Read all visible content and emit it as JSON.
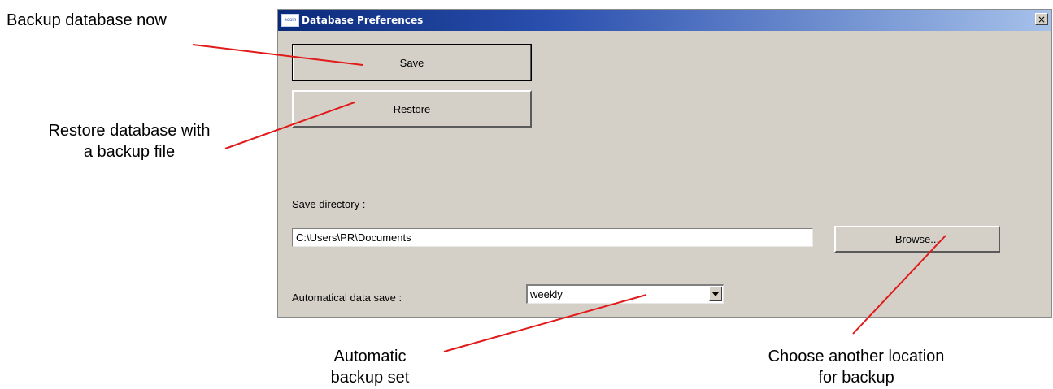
{
  "annotations": {
    "backup_now": "Backup database now",
    "restore_line1": "Restore database with",
    "restore_line2": "a backup file",
    "automatic_line1": "Automatic",
    "automatic_line2": "backup set",
    "choose_line1": "Choose another location",
    "choose_line2": "for backup",
    "line_color": "#e11919"
  },
  "window": {
    "title": "Database Preferences",
    "app_icon_text": "ecom",
    "close_glyph": "×"
  },
  "buttons": {
    "save_label": "Save",
    "restore_label": "Restore",
    "browse_label": "Browse..."
  },
  "save_directory": {
    "label": "Save directory :",
    "value": "C:\\Users\\PR\\Documents"
  },
  "auto_save": {
    "label": "Automatical data save :",
    "selected": "weekly"
  },
  "icons": {
    "app": "app-icon",
    "close": "close-icon",
    "dropdown": "chevron-down-icon"
  }
}
